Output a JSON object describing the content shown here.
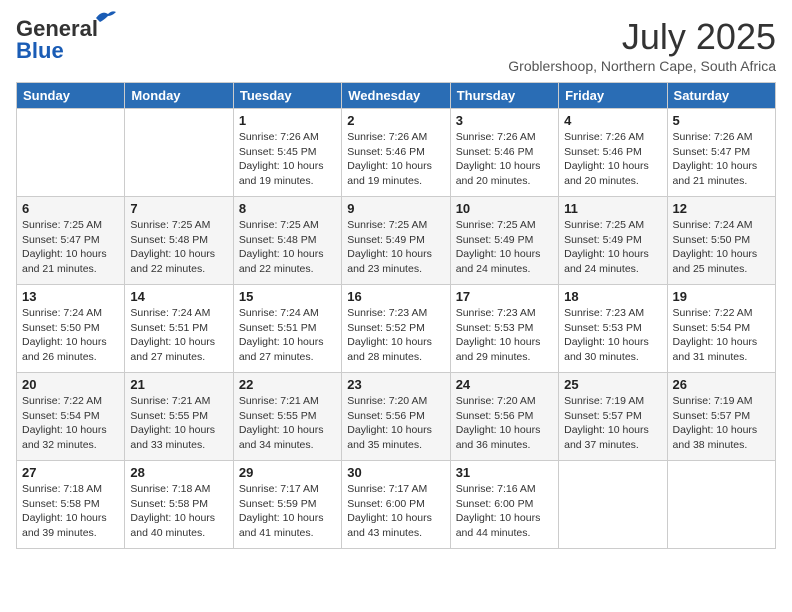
{
  "logo": {
    "line1": "General",
    "line2": "Blue"
  },
  "title": "July 2025",
  "subtitle": "Groblershoop, Northern Cape, South Africa",
  "weekdays": [
    "Sunday",
    "Monday",
    "Tuesday",
    "Wednesday",
    "Thursday",
    "Friday",
    "Saturday"
  ],
  "weeks": [
    [
      {
        "day": "",
        "info": ""
      },
      {
        "day": "",
        "info": ""
      },
      {
        "day": "1",
        "info": "Sunrise: 7:26 AM\nSunset: 5:45 PM\nDaylight: 10 hours and 19 minutes."
      },
      {
        "day": "2",
        "info": "Sunrise: 7:26 AM\nSunset: 5:46 PM\nDaylight: 10 hours and 19 minutes."
      },
      {
        "day": "3",
        "info": "Sunrise: 7:26 AM\nSunset: 5:46 PM\nDaylight: 10 hours and 20 minutes."
      },
      {
        "day": "4",
        "info": "Sunrise: 7:26 AM\nSunset: 5:46 PM\nDaylight: 10 hours and 20 minutes."
      },
      {
        "day": "5",
        "info": "Sunrise: 7:26 AM\nSunset: 5:47 PM\nDaylight: 10 hours and 21 minutes."
      }
    ],
    [
      {
        "day": "6",
        "info": "Sunrise: 7:25 AM\nSunset: 5:47 PM\nDaylight: 10 hours and 21 minutes."
      },
      {
        "day": "7",
        "info": "Sunrise: 7:25 AM\nSunset: 5:48 PM\nDaylight: 10 hours and 22 minutes."
      },
      {
        "day": "8",
        "info": "Sunrise: 7:25 AM\nSunset: 5:48 PM\nDaylight: 10 hours and 22 minutes."
      },
      {
        "day": "9",
        "info": "Sunrise: 7:25 AM\nSunset: 5:49 PM\nDaylight: 10 hours and 23 minutes."
      },
      {
        "day": "10",
        "info": "Sunrise: 7:25 AM\nSunset: 5:49 PM\nDaylight: 10 hours and 24 minutes."
      },
      {
        "day": "11",
        "info": "Sunrise: 7:25 AM\nSunset: 5:49 PM\nDaylight: 10 hours and 24 minutes."
      },
      {
        "day": "12",
        "info": "Sunrise: 7:24 AM\nSunset: 5:50 PM\nDaylight: 10 hours and 25 minutes."
      }
    ],
    [
      {
        "day": "13",
        "info": "Sunrise: 7:24 AM\nSunset: 5:50 PM\nDaylight: 10 hours and 26 minutes."
      },
      {
        "day": "14",
        "info": "Sunrise: 7:24 AM\nSunset: 5:51 PM\nDaylight: 10 hours and 27 minutes."
      },
      {
        "day": "15",
        "info": "Sunrise: 7:24 AM\nSunset: 5:51 PM\nDaylight: 10 hours and 27 minutes."
      },
      {
        "day": "16",
        "info": "Sunrise: 7:23 AM\nSunset: 5:52 PM\nDaylight: 10 hours and 28 minutes."
      },
      {
        "day": "17",
        "info": "Sunrise: 7:23 AM\nSunset: 5:53 PM\nDaylight: 10 hours and 29 minutes."
      },
      {
        "day": "18",
        "info": "Sunrise: 7:23 AM\nSunset: 5:53 PM\nDaylight: 10 hours and 30 minutes."
      },
      {
        "day": "19",
        "info": "Sunrise: 7:22 AM\nSunset: 5:54 PM\nDaylight: 10 hours and 31 minutes."
      }
    ],
    [
      {
        "day": "20",
        "info": "Sunrise: 7:22 AM\nSunset: 5:54 PM\nDaylight: 10 hours and 32 minutes."
      },
      {
        "day": "21",
        "info": "Sunrise: 7:21 AM\nSunset: 5:55 PM\nDaylight: 10 hours and 33 minutes."
      },
      {
        "day": "22",
        "info": "Sunrise: 7:21 AM\nSunset: 5:55 PM\nDaylight: 10 hours and 34 minutes."
      },
      {
        "day": "23",
        "info": "Sunrise: 7:20 AM\nSunset: 5:56 PM\nDaylight: 10 hours and 35 minutes."
      },
      {
        "day": "24",
        "info": "Sunrise: 7:20 AM\nSunset: 5:56 PM\nDaylight: 10 hours and 36 minutes."
      },
      {
        "day": "25",
        "info": "Sunrise: 7:19 AM\nSunset: 5:57 PM\nDaylight: 10 hours and 37 minutes."
      },
      {
        "day": "26",
        "info": "Sunrise: 7:19 AM\nSunset: 5:57 PM\nDaylight: 10 hours and 38 minutes."
      }
    ],
    [
      {
        "day": "27",
        "info": "Sunrise: 7:18 AM\nSunset: 5:58 PM\nDaylight: 10 hours and 39 minutes."
      },
      {
        "day": "28",
        "info": "Sunrise: 7:18 AM\nSunset: 5:58 PM\nDaylight: 10 hours and 40 minutes."
      },
      {
        "day": "29",
        "info": "Sunrise: 7:17 AM\nSunset: 5:59 PM\nDaylight: 10 hours and 41 minutes."
      },
      {
        "day": "30",
        "info": "Sunrise: 7:17 AM\nSunset: 6:00 PM\nDaylight: 10 hours and 43 minutes."
      },
      {
        "day": "31",
        "info": "Sunrise: 7:16 AM\nSunset: 6:00 PM\nDaylight: 10 hours and 44 minutes."
      },
      {
        "day": "",
        "info": ""
      },
      {
        "day": "",
        "info": ""
      }
    ]
  ]
}
